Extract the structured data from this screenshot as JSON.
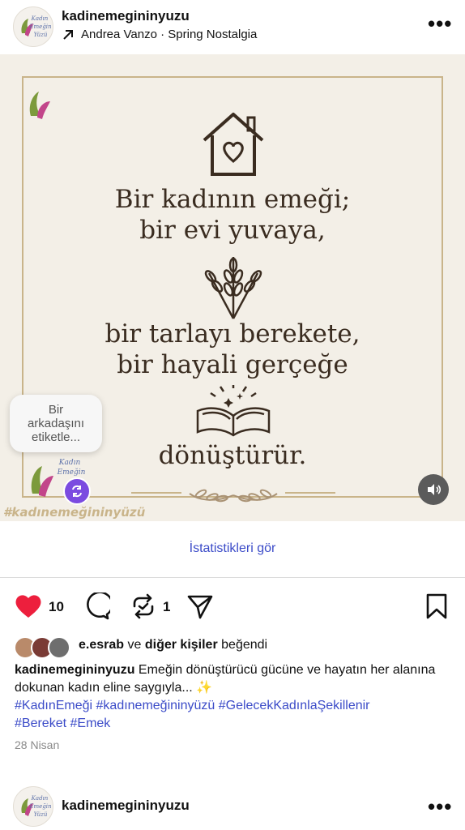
{
  "header": {
    "username": "kadinemegininyuzu",
    "music": "Andrea Vanzo · Spring Nostalgia",
    "more_label": "•••"
  },
  "avatar_text": [
    "Kadın",
    "Emeğin",
    "Yüzü"
  ],
  "post_image": {
    "lines_1": [
      "Bir kadının emeği;",
      "bir evi yuvaya,"
    ],
    "lines_2": [
      "bir tarlayı berekete,",
      "bir hayali gerçeğe"
    ],
    "line_3": "dönüştürür.",
    "overlay_hashtag": "#kadınemeğininyüzü",
    "tag_tooltip": [
      "Bir",
      "arkadaşını",
      "etiketle..."
    ]
  },
  "stats_link": "İstatistikleri gör",
  "actions": {
    "likes_count": "10",
    "reposts_count": "1"
  },
  "liked_by": {
    "user": "e.esrab",
    "connector": "ve",
    "others": "diğer kişiler",
    "suffix": "beğendi"
  },
  "caption": {
    "username": "kadinemegininyuzu",
    "text": "Emeğin dönüştürücü gücüne ve hayatın her alanına dokunan kadın eline saygıyla... ✨",
    "hashtags": [
      "#KadınEmeği",
      "#kadınemeğininyüzü",
      "#GelecekKadınlaŞekillenir",
      "#Bereket",
      "#Emek"
    ]
  },
  "date": "28 Nisan",
  "next_post": {
    "username": "kadinemegininyuzu",
    "more_label": "•••"
  },
  "colors": {
    "heart": "#ed1f3d",
    "link": "#3b4bc8",
    "gold": "#c9b48a",
    "text_dark": "#3a2c20"
  }
}
